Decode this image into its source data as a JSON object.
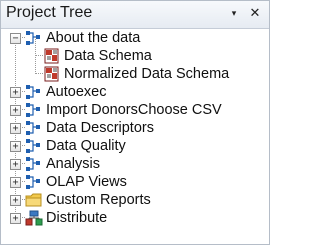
{
  "panel": {
    "title": "Project Tree",
    "pin_glyph": "▾",
    "close_glyph": "✕"
  },
  "tree": {
    "nodes": [
      {
        "label": "About the data",
        "icon": "process-flow-icon",
        "expanded": true,
        "expander": "−",
        "children": [
          {
            "label": "Data Schema",
            "icon": "report-icon"
          },
          {
            "label": "Normalized Data Schema",
            "icon": "report-icon"
          }
        ]
      },
      {
        "label": "Autoexec",
        "icon": "process-flow-icon",
        "expander": "+"
      },
      {
        "label": "Import DonorsChoose CSV",
        "icon": "process-flow-icon",
        "expander": "+"
      },
      {
        "label": "Data Descriptors",
        "icon": "process-flow-icon",
        "expander": "+"
      },
      {
        "label": "Data Quality",
        "icon": "process-flow-icon",
        "expander": "+"
      },
      {
        "label": "Analysis",
        "icon": "process-flow-icon",
        "expander": "+"
      },
      {
        "label": "OLAP Views",
        "icon": "process-flow-icon",
        "expander": "+"
      },
      {
        "label": "Custom Reports",
        "icon": "folder-icon",
        "expander": "+"
      },
      {
        "label": "Distribute",
        "icon": "distribute-icon",
        "expander": "+"
      }
    ]
  },
  "colors": {
    "flow_icon": "#1f5fb0",
    "report_icon": "#c0392b",
    "folder_icon": "#f2c94c"
  }
}
